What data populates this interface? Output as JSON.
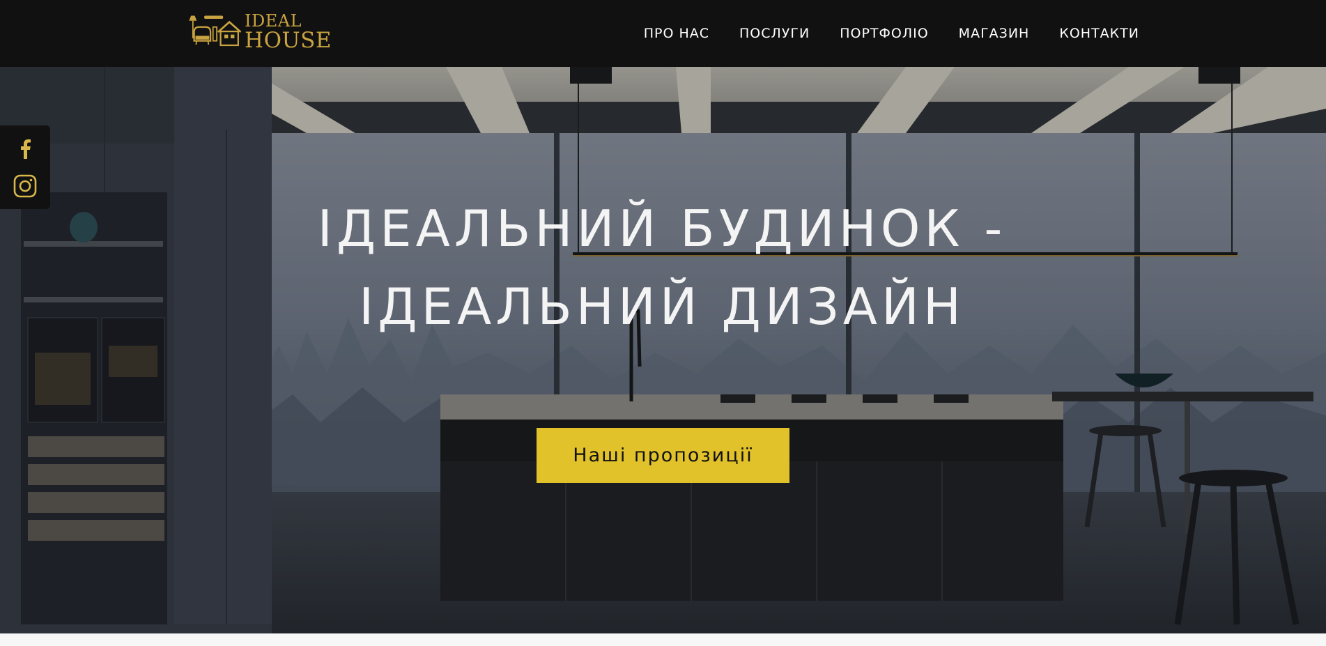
{
  "brand": {
    "name_line1": "IDEAL",
    "name_line2": "HOUSE",
    "color": "#c9a341"
  },
  "nav": {
    "items": [
      {
        "label": "ПРО НАС"
      },
      {
        "label": "ПОСЛУГИ"
      },
      {
        "label": "ПОРТФОЛІО"
      },
      {
        "label": "МАГАЗИН"
      },
      {
        "label": "КОНТАКТИ"
      }
    ]
  },
  "social": {
    "icons": [
      "facebook-icon",
      "instagram-icon"
    ],
    "accent": "#d8b84a"
  },
  "hero": {
    "title_line1": "ІДЕАЛЬНИЙ БУДИНОК -",
    "title_line2": "ІДЕАЛЬНИЙ ДИЗАЙН",
    "cta_label": "Наші пропозиції",
    "cta_color": "#e2c22b",
    "background": "kitchen-interior-forest-view"
  }
}
